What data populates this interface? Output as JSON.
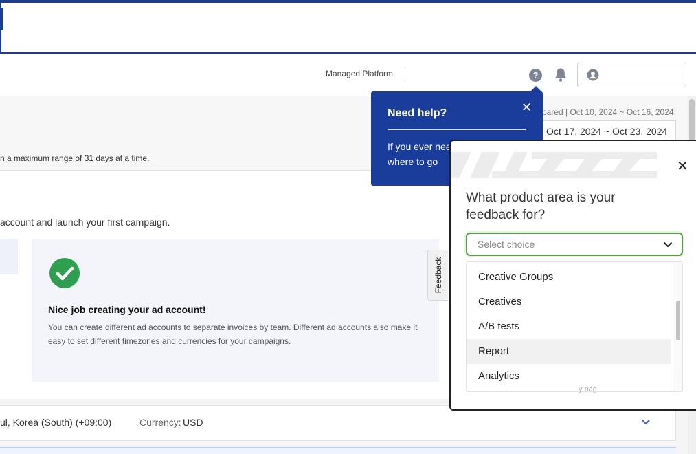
{
  "header": {
    "managed_platform": "Managed Platform"
  },
  "date_range": {
    "compared": "pared | Oct 10, 2024 ~ Oct 16, 2024",
    "current": "Oct 17, 2024 ~ Oct 23, 2024",
    "note": "n a maximum range of 31 days at a time."
  },
  "main": {
    "intro": "account and launch your first campaign.",
    "success_card": {
      "title": "Nice job creating your ad account!",
      "description": "You can create different ad accounts to separate invoices by team. Different ad accounts also make it easy to set different timezones and currencies for your campaigns."
    }
  },
  "feedback_tab": {
    "label": "Feedback"
  },
  "account_bar": {
    "timezone": "ul, Korea (South) (+09:00)",
    "currency_label": "Currency:",
    "currency_value": "USD"
  },
  "help_popover": {
    "title": "Need help?",
    "body_line1": "If you ever nee",
    "body_line2": "where to go"
  },
  "survey": {
    "question": "What product area is your feedback for?",
    "select_placeholder": "Select choice",
    "options": [
      "Creative Groups",
      "Creatives",
      "A/B tests",
      "Report",
      "Analytics"
    ],
    "highlighted_option": "Report",
    "under_text": "y pag"
  },
  "colors": {
    "brand_blue": "#1a3d9c",
    "success_green": "#2e9e4f",
    "select_border_green": "#5b9a4f"
  }
}
